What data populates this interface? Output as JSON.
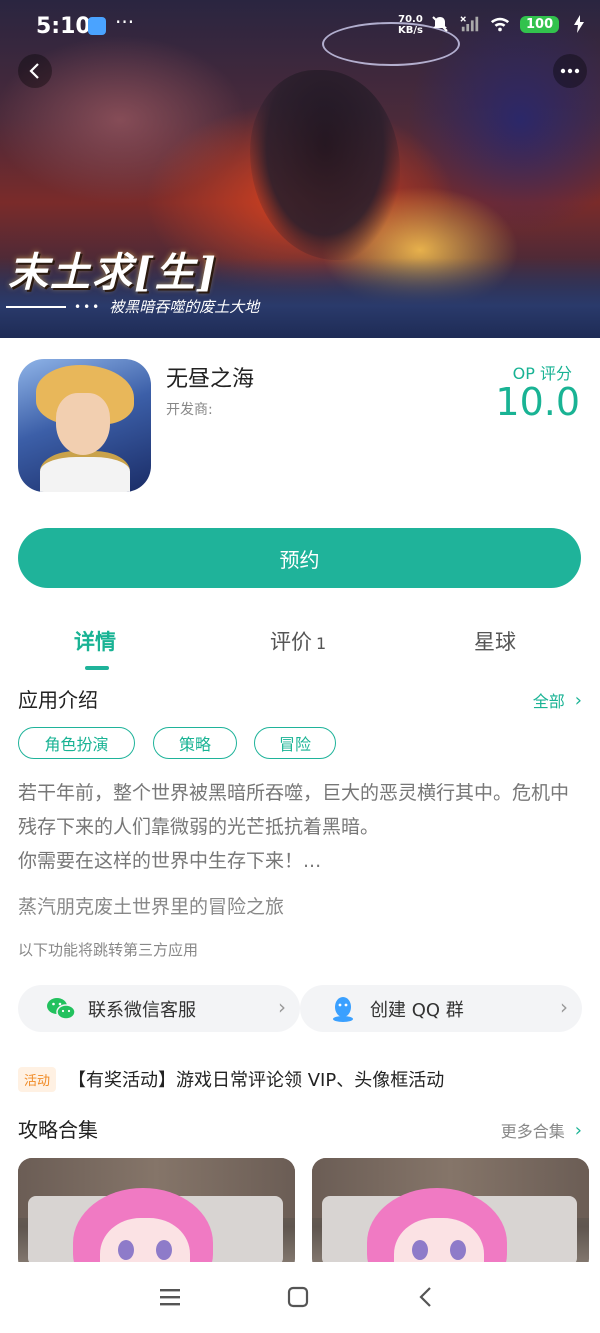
{
  "status_bar": {
    "time": "5:10",
    "speed_value": "70.0",
    "speed_unit": "KB/s",
    "battery": "100"
  },
  "banner": {
    "title": "末土求[生]",
    "subtitle": "被黑暗吞噬的废土大地"
  },
  "app": {
    "name": "无昼之海",
    "developer_label": "开发商:",
    "score_label": "OP 评分",
    "score": "10.0",
    "reserve_button": "预约"
  },
  "tabs": [
    {
      "label": "详情",
      "count": ""
    },
    {
      "label": "评价",
      "count": "1"
    },
    {
      "label": "星球",
      "count": ""
    }
  ],
  "intro": {
    "title": "应用介绍",
    "more": "全部",
    "tags": [
      "角色扮演",
      "策略",
      "冒险"
    ],
    "desc_line1": "若干年前，整个世界被黑暗所吞噬，巨大的恶灵横行其中。危机中残存下来的人们靠微弱的光芒抵抗着黑暗。",
    "desc_line2": "你需要在这样的世界中生存下来！...",
    "tagline": "蒸汽朋克废土世界里的冒险之旅",
    "third_party_note": "以下功能将跳转第三方应用"
  },
  "services": {
    "wechat": "联系微信客服",
    "qq": "创建 QQ 群"
  },
  "activity": {
    "badge": "活动",
    "text": "【有奖活动】游戏日常评论领 VIP、头像框活动"
  },
  "guides": {
    "title": "攻略合集",
    "more": "更多合集"
  },
  "colors": {
    "accent": "#1fb39a",
    "activity_badge": "#f08a24"
  }
}
